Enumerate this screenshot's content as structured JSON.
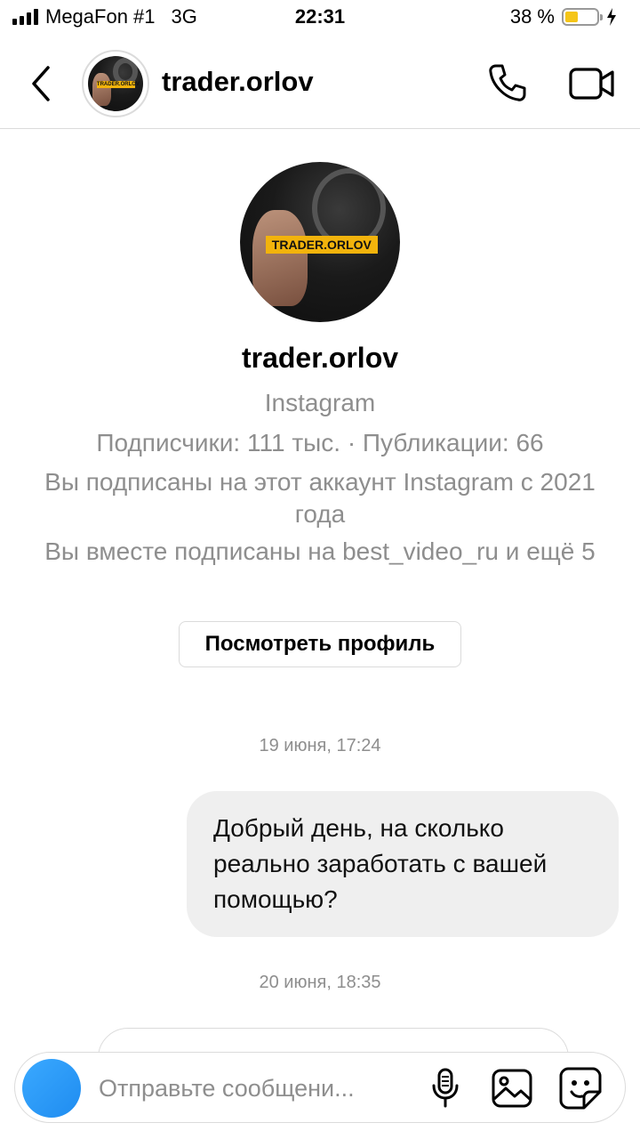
{
  "status_bar": {
    "carrier": "MegaFon #1",
    "network": "3G",
    "time": "22:31",
    "battery": "38 %"
  },
  "header": {
    "title": "trader.orlov",
    "avatar_text": "TRADER.ORLOV"
  },
  "profile": {
    "avatar_text": "TRADER.ORLOV",
    "name": "trader.orlov",
    "platform": "Instagram",
    "stats": "Подписчики: 111 тыс. · Публикации: 66",
    "following_since": "Вы подписаны на этот аккаунт Instagram с 2021 года",
    "mutual": "Вы вместе подписаны на best_video_ru и ещё 5",
    "view_profile_label": "Посмотреть профиль"
  },
  "messages": [
    {
      "timestamp": "19 июня, 17:24",
      "text": "Добрый день, на сколько реально заработать с вашей помощью?"
    },
    {
      "timestamp": "20 июня, 18:35"
    }
  ],
  "composer": {
    "placeholder": "Отправьте сообщени..."
  },
  "colors": {
    "accent": "#1f8cf0",
    "muted": "#8e8e8e",
    "bubble": "#efefef",
    "battery": "#f5c518",
    "tag": "#f2b30c"
  },
  "icons": [
    "back-chevron-icon",
    "phone-icon",
    "video-camera-icon",
    "camera-icon",
    "microphone-icon",
    "gallery-icon",
    "sticker-icon"
  ]
}
